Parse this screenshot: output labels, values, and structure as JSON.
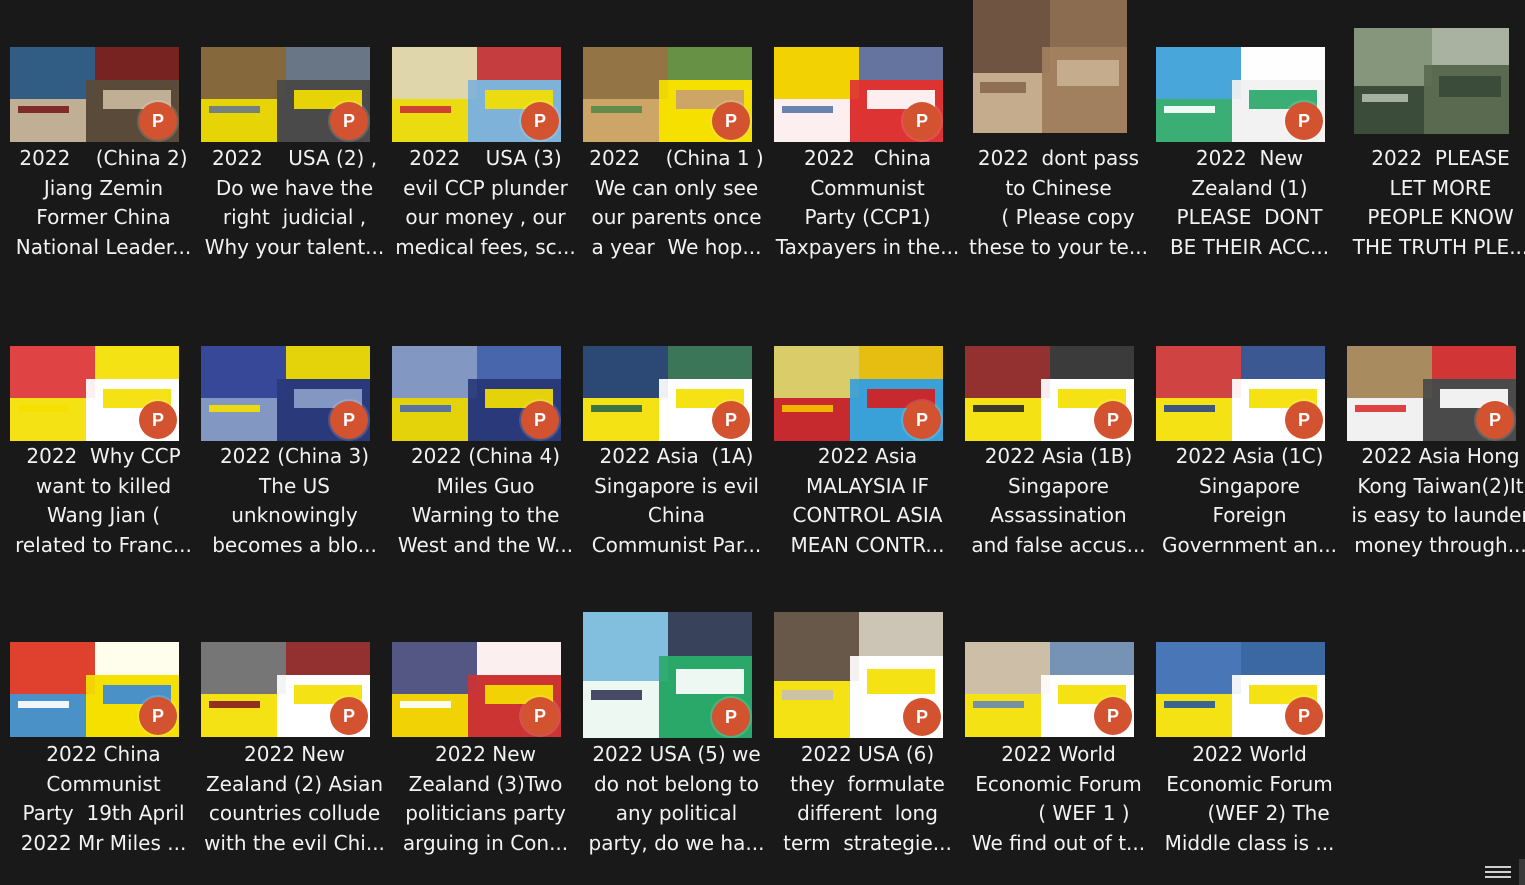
{
  "icons": {
    "file_badge": "powerpoint-icon",
    "badge_letter": "P",
    "view_toggle": "details-view-icon"
  },
  "files": [
    {
      "name": "2022    (China 2)\nJiang Zemin\nFormer China\nNational Leader...",
      "type": "pptx",
      "palette": [
        "#5a4a3a",
        "#2e5e8c",
        "#c9b79c",
        "#7a2020"
      ]
    },
    {
      "name": "2022    USA (2) ,\nDo we have the\nright  judicial ,\nWhy your talent...",
      "type": "pptx",
      "palette": [
        "#4a4a4a",
        "#8a6a3a",
        "#f4e000",
        "#6a7a8a"
      ]
    },
    {
      "name": "2022    USA (3)\nevil CCP plunder\nour money , our\nmedical fees, sc...",
      "type": "pptx",
      "palette": [
        "#7fb2d8",
        "#e8d9a8",
        "#f4e000",
        "#c33"
      ]
    },
    {
      "name": "2022    (China 1 )\nWe can only see\nour parents once\na year  We hop...",
      "type": "pptx",
      "palette": [
        "#f4e000",
        "#8a6a4a",
        "#c8a070",
        "#5a8a4a"
      ]
    },
    {
      "name": "2022   China\nCommunist\nParty (CCP1)\nTaxpayers in the...",
      "type": "pptx",
      "palette": [
        "#d33",
        "#f4e000",
        "#ffffff",
        "#5a7aa8"
      ]
    },
    {
      "name": "2022  dont pass\nto Chinese\n   ( Please copy\nthese to your te...",
      "type": "image",
      "palette": [
        "#a08060",
        "#6a5040",
        "#c8b090",
        "#8a6a50"
      ]
    },
    {
      "name": "2022  New\nZealand (1)\nPLEASE  DONT\nBE THEIR ACC...",
      "type": "pptx",
      "palette": [
        "#f2f2f2",
        "#3aa0d8",
        "#2aa86a",
        "#ffffff"
      ]
    },
    {
      "name": "2022  PLEASE\nLET MORE\nPEOPLE KNOW\nTHE TRUTH PLE...",
      "type": "image",
      "palette": [
        "#5a6a50",
        "#8a9a80",
        "#3a4a3a",
        "#b0b8a8"
      ]
    },
    {
      "name": "2022  Why CCP\nwant to killed\nWang Jian (\nrelated to Franc...",
      "type": "pptx",
      "palette": [
        "#ffffff",
        "#d33",
        "#f4e000",
        "#f4e000"
      ]
    },
    {
      "name": "2022 (China 3)\nThe US\nunknowingly\nbecomes a blo...",
      "type": "pptx",
      "palette": [
        "#2a3a7a",
        "#3a4a9a",
        "#8aa0c8",
        "#f4e000"
      ]
    },
    {
      "name": "2022 (China 4)\nMiles Guo\nWarning to the\nWest and the W...",
      "type": "pptx",
      "palette": [
        "#2a3a7a",
        "#8aa0c8",
        "#f4e000",
        "#4a6ab0"
      ]
    },
    {
      "name": "2022 Asia  (1A)\nSingapore is evil\nChina\nCommunist Par...",
      "type": "pptx",
      "palette": [
        "#ffffff",
        "#1a3a6a",
        "#f4e000",
        "#2a6a4a"
      ]
    },
    {
      "name": "2022 Asia\nMALAYSIA IF\nCONTROL ASIA\nMEAN CONTR...",
      "type": "pptx",
      "palette": [
        "#3aa0d8",
        "#e8d060",
        "#d32020",
        "#f4c000"
      ]
    },
    {
      "name": "2022 Asia (1B)\nSingapore\nAssassination\nand false accus...",
      "type": "pptx",
      "palette": [
        "#ffffff",
        "#8a2020",
        "#f4e000",
        "#2a2a2a"
      ]
    },
    {
      "name": "2022 Asia (1C)\nSingapore\nForeign\nGovernment an...",
      "type": "pptx",
      "palette": [
        "#ffffff",
        "#c33",
        "#f4e000",
        "#2a4a8a"
      ]
    },
    {
      "name": "2022 Asia Hong\nKong Taiwan(2)It\nis easy to launder\nmoney through...",
      "type": "pptx",
      "palette": [
        "#4a4a4a",
        "#b09060",
        "#ffffff",
        "#d33"
      ]
    },
    {
      "name": "2022 China\nCommunist\nParty  19th April\n2022 Mr Miles ...",
      "type": "pptx",
      "palette": [
        "#f4e000",
        "#d33",
        "#3a8ad8",
        "#ffffff"
      ]
    },
    {
      "name": "2022 New\nZealand (2) Asian\ncountries collude\nwith the evil Chi...",
      "type": "pptx",
      "palette": [
        "#ffffff",
        "#6a6a6a",
        "#f4e000",
        "#8a2020"
      ]
    },
    {
      "name": "2022 New\nZealand (3)Two\npoliticians party\narguing in Con...",
      "type": "pptx",
      "palette": [
        "#c33",
        "#4a5a8a",
        "#f4e000",
        "#ffffff"
      ]
    },
    {
      "name": "2022 USA (5) we\ndo not belong to\nany political\nparty, do we ha...",
      "type": "pptx",
      "palette": [
        "#2aa86a",
        "#8ac0e8",
        "#ffffff",
        "#3a3a5a"
      ]
    },
    {
      "name": "2022 USA (6)\nthey  formulate\ndifferent  long\nterm  strategie...",
      "type": "pptx",
      "palette": [
        "#ffffff",
        "#5a4a3a",
        "#f4e000",
        "#c8c0b0"
      ]
    },
    {
      "name": "2022 World\nEconomic Forum\n        ( WEF 1 )\nWe find out of t...",
      "type": "pptx",
      "palette": [
        "#ffffff",
        "#c8b8a0",
        "#f4e000",
        "#6a8ab0"
      ]
    },
    {
      "name": "2022 World\nEconomic Forum\n      (WEF 2) The\nMiddle class is ...",
      "type": "pptx",
      "palette": [
        "#ffffff",
        "#3a6ab0",
        "#f4e000",
        "#2a5a9a"
      ]
    }
  ]
}
